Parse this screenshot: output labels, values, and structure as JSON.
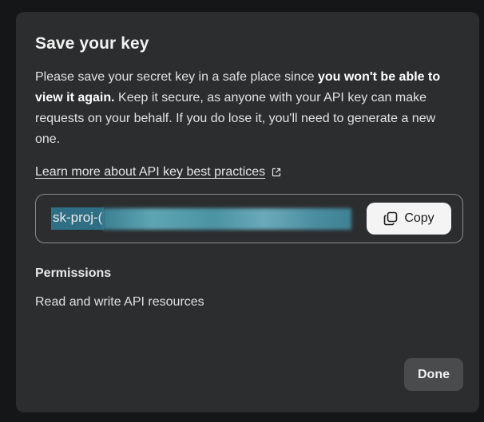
{
  "dialog": {
    "title": "Save your key",
    "description_part1": "Please save your secret key in a safe place since ",
    "description_bold": "you won't be able to view it again.",
    "description_part2": " Keep it secure, as anyone with your API key can make requests on your behalf. If you do lose it, you'll need to generate a new one.",
    "learn_more_link": "Learn more about API key best practices",
    "link_icon": "external-link-icon",
    "key_prefix": "sk-proj-(",
    "copy_label": "Copy",
    "copy_icon": "copy-icon",
    "permissions_title": "Permissions",
    "permissions_value": "Read and write API resources",
    "done_label": "Done"
  },
  "colors": {
    "modal_bg": "#2c2d2f",
    "key_highlight": "#2f6f86",
    "copy_bg": "#f4f4f4",
    "done_bg": "#4a4b4d"
  }
}
